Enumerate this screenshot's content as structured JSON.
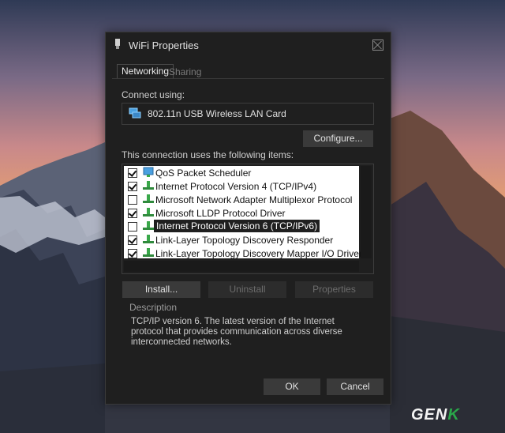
{
  "window": {
    "title": "WiFi Properties"
  },
  "tabs": [
    {
      "label": "Networking",
      "active": true
    },
    {
      "label": "Sharing",
      "active": false
    }
  ],
  "connect_using": {
    "label": "Connect using:",
    "adapter": "802.11n USB Wireless LAN Card"
  },
  "buttons": {
    "configure": "Configure...",
    "install": "Install...",
    "uninstall": "Uninstall",
    "properties": "Properties",
    "ok": "OK",
    "cancel": "Cancel"
  },
  "items_label": "This connection uses the following items:",
  "items": [
    {
      "label": "QoS Packet Scheduler",
      "checked": true,
      "icon": "qos-scheduler-icon"
    },
    {
      "label": "Internet Protocol Version 4 (TCP/IPv4)",
      "checked": true,
      "icon": "network-protocol-icon"
    },
    {
      "label": "Microsoft Network Adapter Multiplexor Protocol",
      "checked": false,
      "icon": "network-protocol-icon"
    },
    {
      "label": "Microsoft LLDP Protocol Driver",
      "checked": true,
      "icon": "network-protocol-icon"
    },
    {
      "label": "Internet Protocol Version 6 (TCP/IPv6)",
      "checked": false,
      "icon": "network-protocol-icon",
      "selected": true
    },
    {
      "label": "Link-Layer Topology Discovery Responder",
      "checked": true,
      "icon": "network-protocol-icon"
    },
    {
      "label": "Link-Layer Topology Discovery Mapper I/O Driver",
      "checked": true,
      "icon": "network-protocol-icon"
    }
  ],
  "description": {
    "title": "Description",
    "text": "TCP/IP version 6. The latest version of the Internet protocol that provides communication across diverse interconnected networks."
  },
  "watermark": {
    "part1": "GEN",
    "part2": "K"
  },
  "colors": {
    "dialog_bg": "#1f1f1f",
    "button_bg": "#3a3a3a",
    "protocol_icon": "#3aa84a"
  }
}
